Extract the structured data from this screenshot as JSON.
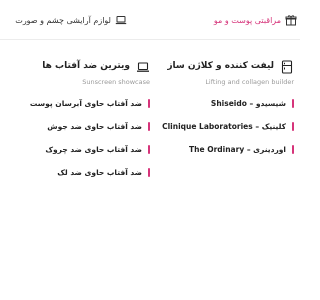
{
  "tabs": [
    {
      "label": "مراقبتی پوست و مو",
      "icon": "gift-box-icon",
      "active": true
    },
    {
      "label": "لوازم آرایشی چشم و صورت",
      "icon": "laptop-icon",
      "active": false
    }
  ],
  "menu": {
    "right_column": {
      "icon": "refrigerator-icon",
      "title": "لیفت کننده و کلاژن ساز",
      "subtitle": "Lifting and collagen builder",
      "items": [
        "شیسیدو – Shiseido",
        "کلینیک – Clinique Laboratories",
        "اوردینری – The Ordinary"
      ]
    },
    "left_column": {
      "icon": "laptop-icon",
      "title": "ویترین ضد آفتاب ها",
      "subtitle": "Sunscreen showcase",
      "items": [
        "ضد آفتاب حاوی آبرسان پوست",
        "ضد آفتاب حاوی ضد جوش",
        "ضد آفتاب حاوی ضد چروک",
        "ضد آفتاب حاوی ضد لک"
      ]
    }
  },
  "colors": {
    "accent": "#d6347a",
    "text": "#222222",
    "muted": "#9a9a9a"
  }
}
